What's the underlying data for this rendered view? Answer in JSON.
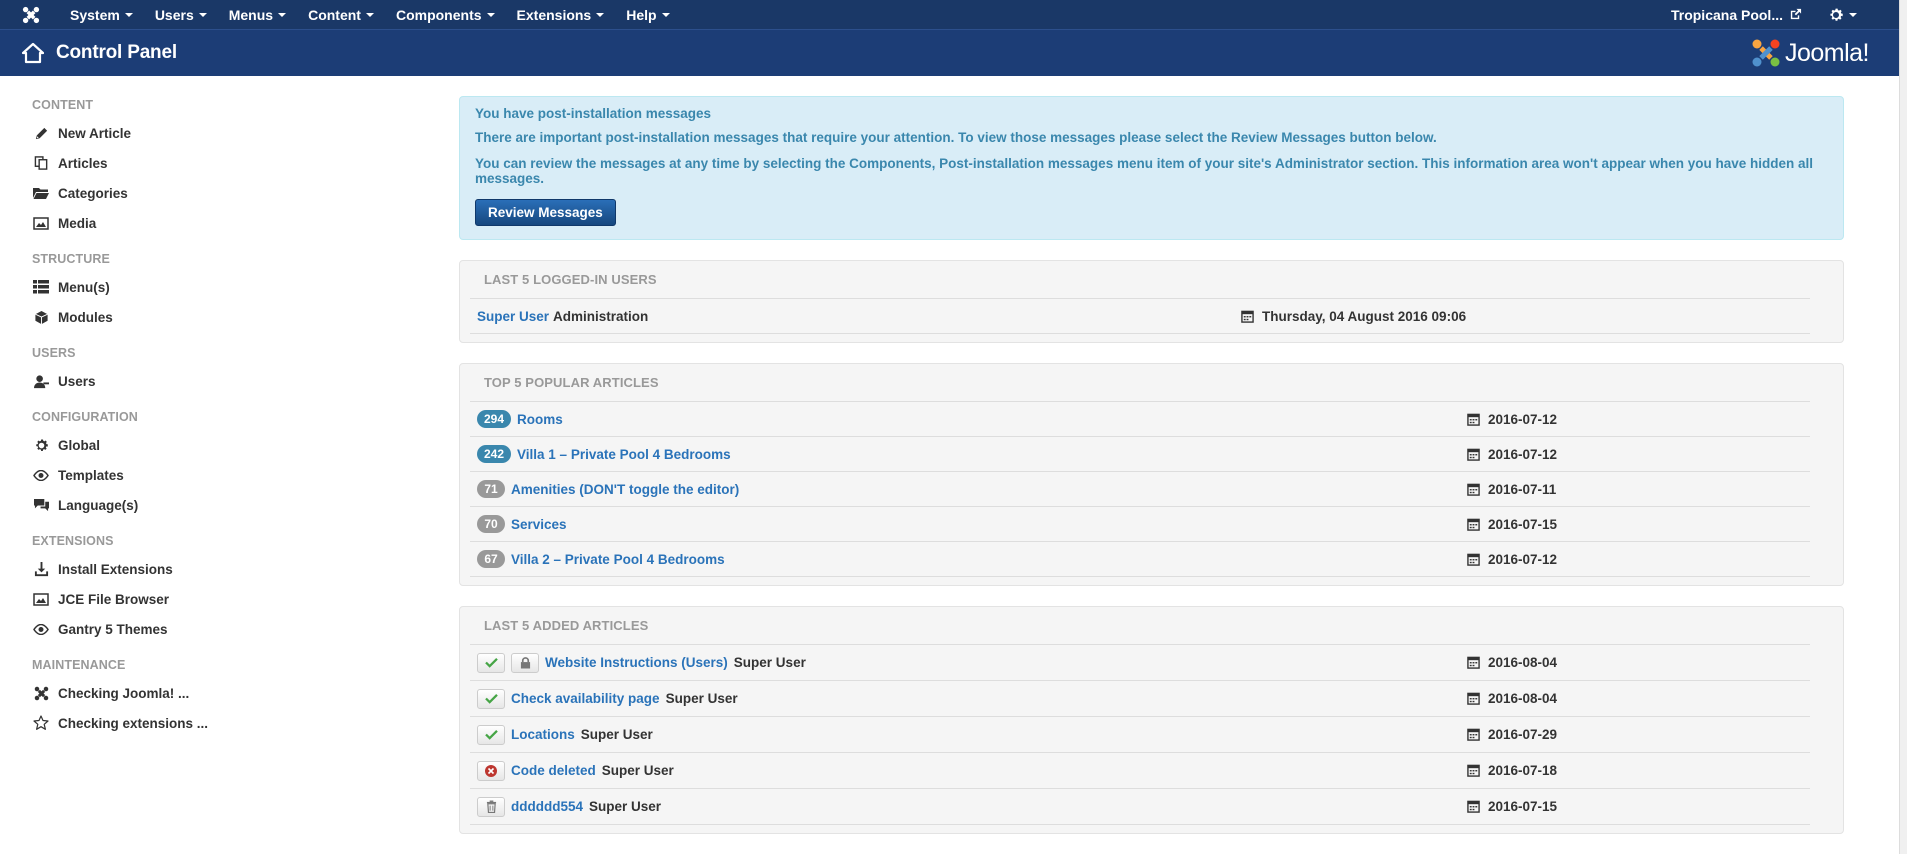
{
  "colors": {
    "navbar": "#1a3867",
    "subhead": "#1c3d76",
    "link": "#2a73b9",
    "alert_bg": "#d9edf7",
    "badge_info": "#3a87ad",
    "badge_gray": "#999999",
    "success": "#46a546",
    "danger": "#bd362f"
  },
  "navbar": {
    "brand_icon": "joomla-icon",
    "menus": [
      {
        "label": "System"
      },
      {
        "label": "Users"
      },
      {
        "label": "Menus"
      },
      {
        "label": "Content"
      },
      {
        "label": "Components"
      },
      {
        "label": "Extensions"
      },
      {
        "label": "Help"
      }
    ],
    "site_label": "Tropicana Pool...",
    "external_icon": "external-link-icon",
    "settings_icon": "gear-icon"
  },
  "subhead": {
    "title": "Control Panel",
    "home_icon": "home-icon",
    "logo_text": "Joomla!"
  },
  "sidebar": {
    "sections": [
      {
        "heading": "CONTENT",
        "items": [
          {
            "label": "New Article",
            "icon": "pencil-icon"
          },
          {
            "label": "Articles",
            "icon": "copy-icon"
          },
          {
            "label": "Categories",
            "icon": "folder-icon"
          },
          {
            "label": "Media",
            "icon": "image-icon"
          }
        ]
      },
      {
        "heading": "STRUCTURE",
        "items": [
          {
            "label": "Menu(s)",
            "icon": "list-icon"
          },
          {
            "label": "Modules",
            "icon": "cube-icon"
          }
        ]
      },
      {
        "heading": "USERS",
        "items": [
          {
            "label": "Users",
            "icon": "user-icon"
          }
        ]
      },
      {
        "heading": "CONFIGURATION",
        "items": [
          {
            "label": "Global",
            "icon": "cog-icon"
          },
          {
            "label": "Templates",
            "icon": "eye-icon"
          },
          {
            "label": "Language(s)",
            "icon": "comments-icon"
          }
        ]
      },
      {
        "heading": "EXTENSIONS",
        "items": [
          {
            "label": "Install Extensions",
            "icon": "download-icon"
          },
          {
            "label": "JCE File Browser",
            "icon": "image-icon"
          },
          {
            "label": "Gantry 5 Themes",
            "icon": "eye-icon"
          }
        ]
      },
      {
        "heading": "MAINTENANCE",
        "items": [
          {
            "label": "Checking Joomla! ...",
            "icon": "joomla-icon"
          },
          {
            "label": "Checking extensions ...",
            "icon": "star-icon"
          }
        ]
      }
    ]
  },
  "alert": {
    "title": "You have post-installation messages",
    "line1": "There are important post-installation messages that require your attention. To view those messages please select the Review Messages button below.",
    "line2": "You can review the messages at any time by selecting the Components, Post-installation messages menu item of your site's Administrator section. This information area won't appear when you have hidden all messages.",
    "button": "Review Messages"
  },
  "logged_users": {
    "title": "LAST 5 LOGGED-IN USERS",
    "rows": [
      {
        "user": "Super User",
        "area": "Administration",
        "date": "Thursday, 04 August 2016 09:06"
      }
    ]
  },
  "popular": {
    "title": "TOP 5 POPULAR ARTICLES",
    "rows": [
      {
        "hits": "294",
        "title": "Rooms",
        "date": "2016-07-12",
        "badge": "info"
      },
      {
        "hits": "242",
        "title": "Villa 1 – Private Pool 4 Bedrooms",
        "date": "2016-07-12",
        "badge": "info"
      },
      {
        "hits": "71",
        "title": "Amenities (DON'T toggle the editor)",
        "date": "2016-07-11",
        "badge": "gray"
      },
      {
        "hits": "70",
        "title": "Services",
        "date": "2016-07-15",
        "badge": "gray"
      },
      {
        "hits": "67",
        "title": "Villa 2 – Private Pool 4 Bedrooms",
        "date": "2016-07-12",
        "badge": "gray"
      }
    ]
  },
  "added": {
    "title": "LAST 5 ADDED ARTICLES",
    "rows": [
      {
        "status": "published",
        "locked": true,
        "title": "Website Instructions (Users)",
        "author": "Super User",
        "date": "2016-08-04"
      },
      {
        "status": "published",
        "locked": false,
        "title": "Check availability page",
        "author": "Super User",
        "date": "2016-08-04"
      },
      {
        "status": "published",
        "locked": false,
        "title": "Locations",
        "author": "Super User",
        "date": "2016-07-29"
      },
      {
        "status": "unpublished",
        "locked": false,
        "title": "Code deleted",
        "author": "Super User",
        "date": "2016-07-18"
      },
      {
        "status": "trashed",
        "locked": false,
        "title": "dddddd554",
        "author": "Super User",
        "date": "2016-07-15"
      }
    ]
  }
}
